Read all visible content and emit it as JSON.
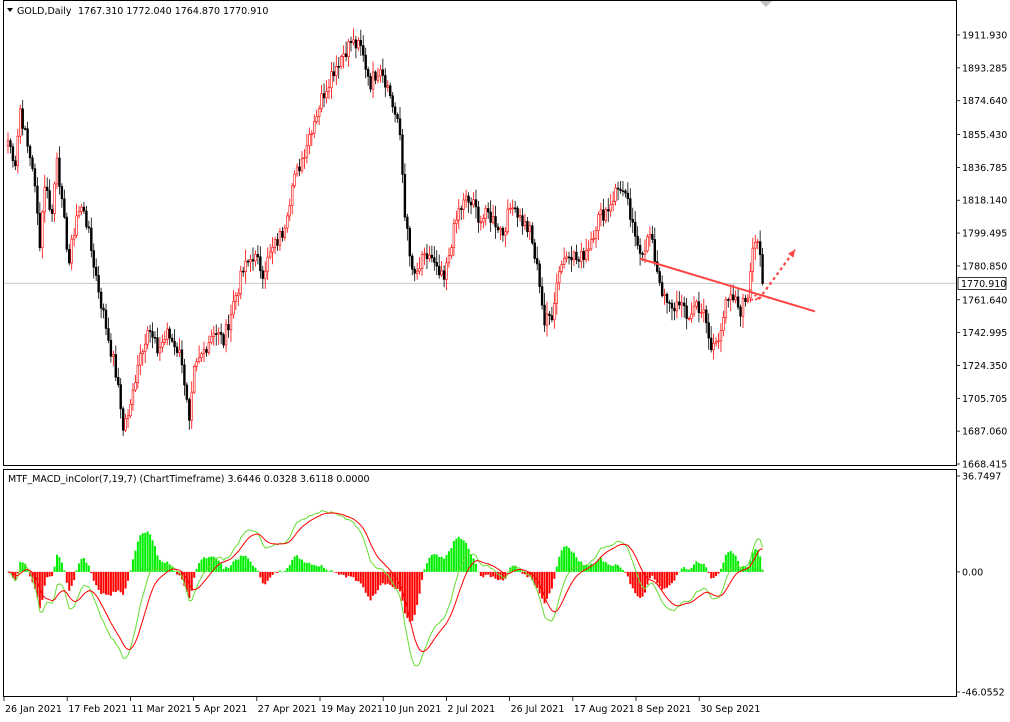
{
  "header": {
    "symbol": "GOLD,Daily",
    "ohlc": "1767.310 1772.040 1764.870 1770.910"
  },
  "indicator": {
    "label": "MTF_MACD_inColor(7,19,7) (ChartTimeframe) 3.6446 0.0328 3.6118 0.0000"
  },
  "colors": {
    "bull": "#ff0000",
    "bear": "#000000",
    "hist_up": "#00ee00",
    "hist_down": "#ff0000",
    "macd_line": "#66dd33",
    "signal_line": "#ff0000",
    "trendline": "#ff4444",
    "grid": "#c8c8c8"
  },
  "chart_data": [
    {
      "type": "candlestick",
      "title": "GOLD,Daily",
      "y_ticks": [
        "1911.930",
        "1893.285",
        "1874.640",
        "1855.430",
        "1836.785",
        "1818.140",
        "1799.495",
        "1780.850",
        "1761.640",
        "1742.995",
        "1724.350",
        "1705.705",
        "1687.060",
        "1668.415"
      ],
      "ylim": [
        1666,
        1921
      ],
      "current_price": "1770.910",
      "x_tick_labels": [
        "26 Jan 2021",
        "17 Feb 2021",
        "11 Mar 2021",
        "5 Apr 2021",
        "27 Apr 2021",
        "19 May 2021",
        "10 Jun 2021",
        "2 Jul 2021",
        "26 Jul 2021",
        "17 Aug 2021",
        "8 Sep 2021",
        "30 Sep 2021"
      ],
      "anchors": [
        [
          0,
          1852
        ],
        [
          3,
          1840
        ],
        [
          5,
          1870
        ],
        [
          8,
          1848
        ],
        [
          10,
          1838
        ],
        [
          13,
          1795
        ],
        [
          15,
          1828
        ],
        [
          18,
          1810
        ],
        [
          20,
          1845
        ],
        [
          22,
          1815
        ],
        [
          25,
          1783
        ],
        [
          28,
          1810
        ],
        [
          31,
          1814
        ],
        [
          34,
          1790
        ],
        [
          38,
          1760
        ],
        [
          41,
          1740
        ],
        [
          44,
          1720
        ],
        [
          47,
          1690
        ],
        [
          50,
          1700
        ],
        [
          53,
          1727
        ],
        [
          57,
          1745
        ],
        [
          61,
          1733
        ],
        [
          65,
          1742
        ],
        [
          68,
          1737
        ],
        [
          71,
          1728
        ],
        [
          74,
          1690
        ],
        [
          76,
          1720
        ],
        [
          80,
          1733
        ],
        [
          84,
          1745
        ],
        [
          88,
          1738
        ],
        [
          92,
          1760
        ],
        [
          96,
          1778
        ],
        [
          100,
          1787
        ],
        [
          104,
          1778
        ],
        [
          108,
          1790
        ],
        [
          112,
          1800
        ],
        [
          116,
          1826
        ],
        [
          120,
          1842
        ],
        [
          124,
          1860
        ],
        [
          128,
          1876
        ],
        [
          132,
          1890
        ],
        [
          136,
          1900
        ],
        [
          140,
          1908
        ],
        [
          144,
          1904
        ],
        [
          148,
          1885
        ],
        [
          152,
          1895
        ],
        [
          156,
          1878
        ],
        [
          160,
          1855
        ],
        [
          162,
          1812
        ],
        [
          164,
          1785
        ],
        [
          166,
          1773
        ],
        [
          169,
          1783
        ],
        [
          172,
          1787
        ],
        [
          175,
          1777
        ],
        [
          178,
          1772
        ],
        [
          181,
          1795
        ],
        [
          184,
          1812
        ],
        [
          187,
          1818
        ],
        [
          190,
          1815
        ],
        [
          193,
          1807
        ],
        [
          196,
          1810
        ],
        [
          199,
          1806
        ],
        [
          202,
          1800
        ],
        [
          206,
          1818
        ],
        [
          209,
          1808
        ],
        [
          213,
          1800
        ],
        [
          217,
          1772
        ],
        [
          219,
          1748
        ],
        [
          222,
          1754
        ],
        [
          225,
          1780
        ],
        [
          229,
          1790
        ],
        [
          233,
          1783
        ],
        [
          237,
          1793
        ],
        [
          241,
          1808
        ],
        [
          245,
          1814
        ],
        [
          248,
          1823
        ],
        [
          250,
          1826
        ],
        [
          253,
          1815
        ],
        [
          256,
          1795
        ],
        [
          259,
          1790
        ],
        [
          262,
          1798
        ],
        [
          265,
          1779
        ],
        [
          268,
          1761
        ],
        [
          271,
          1755
        ],
        [
          274,
          1762
        ],
        [
          277,
          1750
        ],
        [
          281,
          1760
        ],
        [
          284,
          1753
        ],
        [
          287,
          1733
        ],
        [
          290,
          1742
        ],
        [
          293,
          1758
        ],
        [
          296,
          1762
        ],
        [
          299,
          1756
        ],
        [
          302,
          1765
        ],
        [
          304,
          1795
        ],
        [
          306,
          1796
        ],
        [
          308,
          1770
        ]
      ],
      "trendline": [
        [
          640,
          1785
        ],
        [
          815,
          1755
        ]
      ],
      "arrow": [
        [
          759,
          1762
        ],
        [
          795,
          1790
        ]
      ]
    },
    {
      "type": "macd",
      "title": "MTF_MACD_inColor(7,19,7)",
      "y_ticks": [
        "36.7497",
        "0.00",
        "-46.0552"
      ],
      "ylim": [
        -46.0552,
        36.7497
      ],
      "values": {
        "macd": "3.6446",
        "signal": "0.0328",
        "hist_up": "3.6118",
        "hist_down": "0.0000"
      }
    }
  ]
}
